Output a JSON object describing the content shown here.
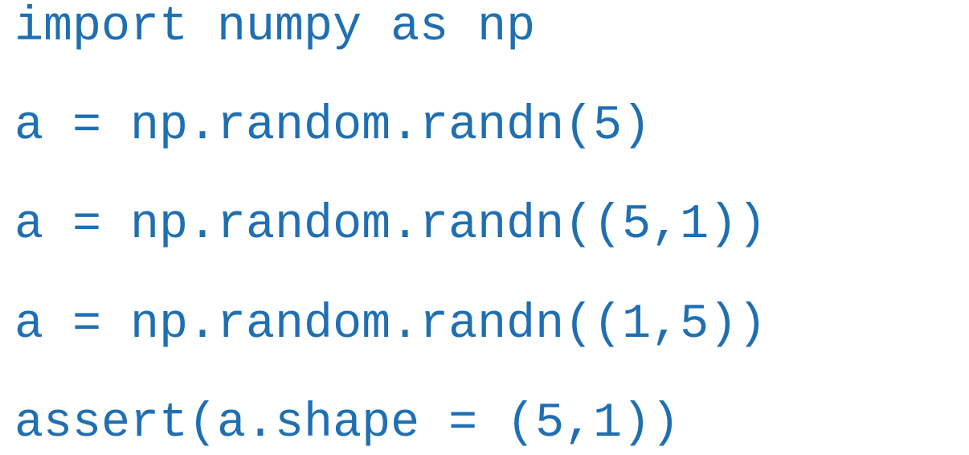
{
  "code": {
    "text_color": "#1f6fb2",
    "lines": [
      "import numpy as np",
      "a = np.random.randn(5)",
      "a = np.random.randn((5,1))",
      "a = np.random.randn((1,5))",
      "assert(a.shape = (5,1))"
    ]
  }
}
